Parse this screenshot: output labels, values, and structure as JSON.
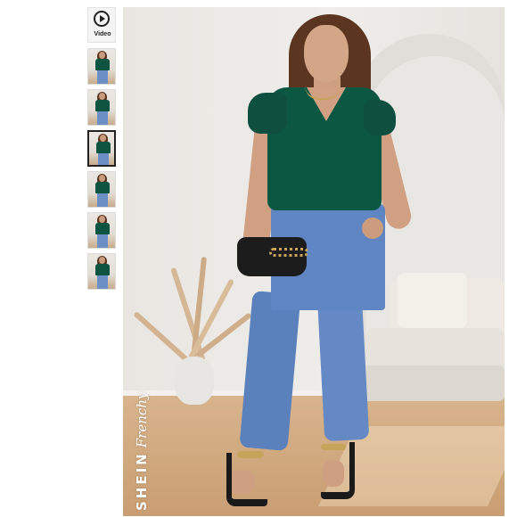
{
  "gallery": {
    "video_thumb": {
      "label": "Video",
      "icon": "play-icon"
    },
    "thumbnails": [
      {
        "selected": false
      },
      {
        "selected": false
      },
      {
        "selected": true
      },
      {
        "selected": false
      },
      {
        "selected": false
      },
      {
        "selected": false
      }
    ]
  },
  "main_image": {
    "watermark": {
      "brand": "SHEIN",
      "sub": "Frenchy"
    }
  },
  "colors": {
    "top_green": "#0c5742",
    "denim_blue": "#5f86c2",
    "selected_border": "#222222"
  }
}
